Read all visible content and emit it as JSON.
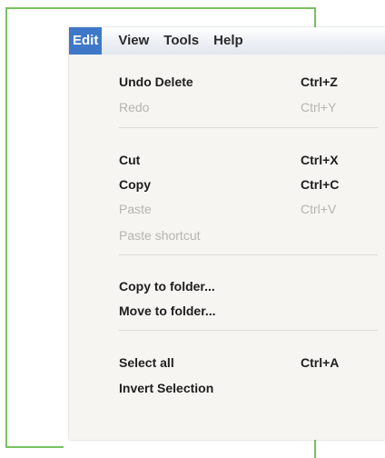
{
  "menubar": {
    "menus": [
      "Edit",
      "View",
      "Tools",
      "Help"
    ]
  },
  "edit_menu": {
    "items": [
      {
        "label": "Undo Delete",
        "shortcut": "Ctrl+Z",
        "enabled": true
      },
      {
        "label": "Redo",
        "shortcut": "Ctrl+Y",
        "enabled": false
      },
      {
        "label": "Cut",
        "shortcut": "Ctrl+X",
        "enabled": true
      },
      {
        "label": "Copy",
        "shortcut": "Ctrl+C",
        "enabled": true
      },
      {
        "label": "Paste",
        "shortcut": "Ctrl+V",
        "enabled": false
      },
      {
        "label": "Paste shortcut",
        "shortcut": "",
        "enabled": false
      },
      {
        "label": "Copy to folder...",
        "shortcut": "",
        "enabled": true
      },
      {
        "label": "Move to folder...",
        "shortcut": "",
        "enabled": true
      },
      {
        "label": "Select all",
        "shortcut": "Ctrl+A",
        "enabled": true
      },
      {
        "label": "Invert Selection",
        "shortcut": "",
        "enabled": true
      }
    ]
  },
  "colors": {
    "frame_border": "#79c15f",
    "active_menu_bg": "#3f78c8",
    "disabled_text": "#b4b4b0"
  }
}
